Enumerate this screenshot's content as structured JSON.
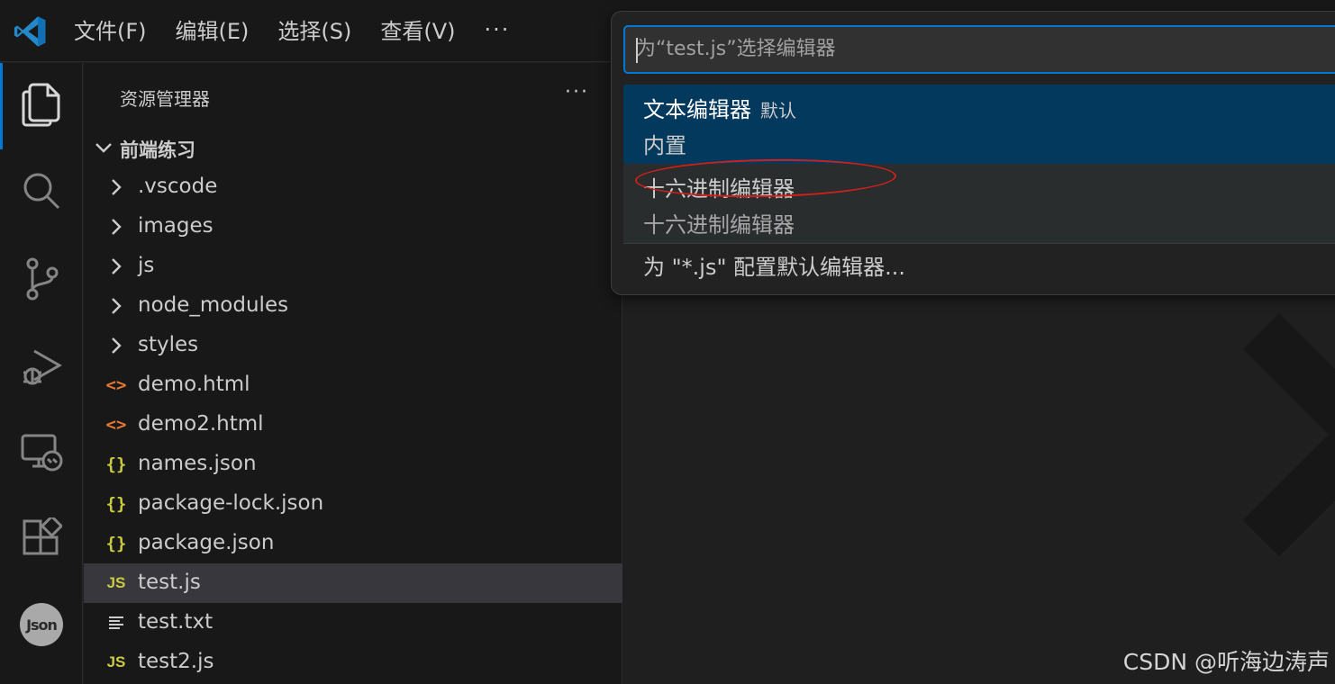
{
  "menu": {
    "items": [
      "文件(F)",
      "编辑(E)",
      "选择(S)",
      "查看(V)"
    ],
    "more": "···"
  },
  "activity_bar": {
    "icons": [
      "explorer-icon",
      "search-icon",
      "source-control-icon",
      "run-debug-icon",
      "remote-explorer-icon",
      "extensions-icon",
      "json-extension-icon"
    ],
    "json_badge": "Json",
    "accent": "#0078d4"
  },
  "sidebar": {
    "header": "资源管理器",
    "more": "···",
    "folder": "前端练习",
    "items": [
      {
        "label": ".vscode",
        "type": "folder"
      },
      {
        "label": "images",
        "type": "folder"
      },
      {
        "label": "js",
        "type": "folder"
      },
      {
        "label": "node_modules",
        "type": "folder"
      },
      {
        "label": "styles",
        "type": "folder"
      },
      {
        "label": "demo.html",
        "type": "html"
      },
      {
        "label": "demo2.html",
        "type": "html"
      },
      {
        "label": "names.json",
        "type": "json"
      },
      {
        "label": "package-lock.json",
        "type": "json"
      },
      {
        "label": "package.json",
        "type": "json"
      },
      {
        "label": "test.js",
        "type": "js",
        "selected": true
      },
      {
        "label": "test.txt",
        "type": "txt"
      },
      {
        "label": "test2.js",
        "type": "js"
      }
    ],
    "icon_glyphs": {
      "html": "<>",
      "json": "{}",
      "js": "JS"
    }
  },
  "quick_pick": {
    "placeholder": "为“test.js”选择编辑器",
    "options": [
      {
        "title": "文本编辑器",
        "description": "默认",
        "detail": "内置"
      },
      {
        "title": "十六进制编辑器",
        "detail": "十六进制编辑器"
      }
    ],
    "configure": "为 \"*.js\" 配置默认编辑器..."
  },
  "watermark": "CSDN @听海边涛声",
  "colors": {
    "annotation_ellipse": "#d0201c",
    "focused_option": "#04395e",
    "html_icon": "#e37933",
    "json_js_icon": "#cbcb41"
  }
}
